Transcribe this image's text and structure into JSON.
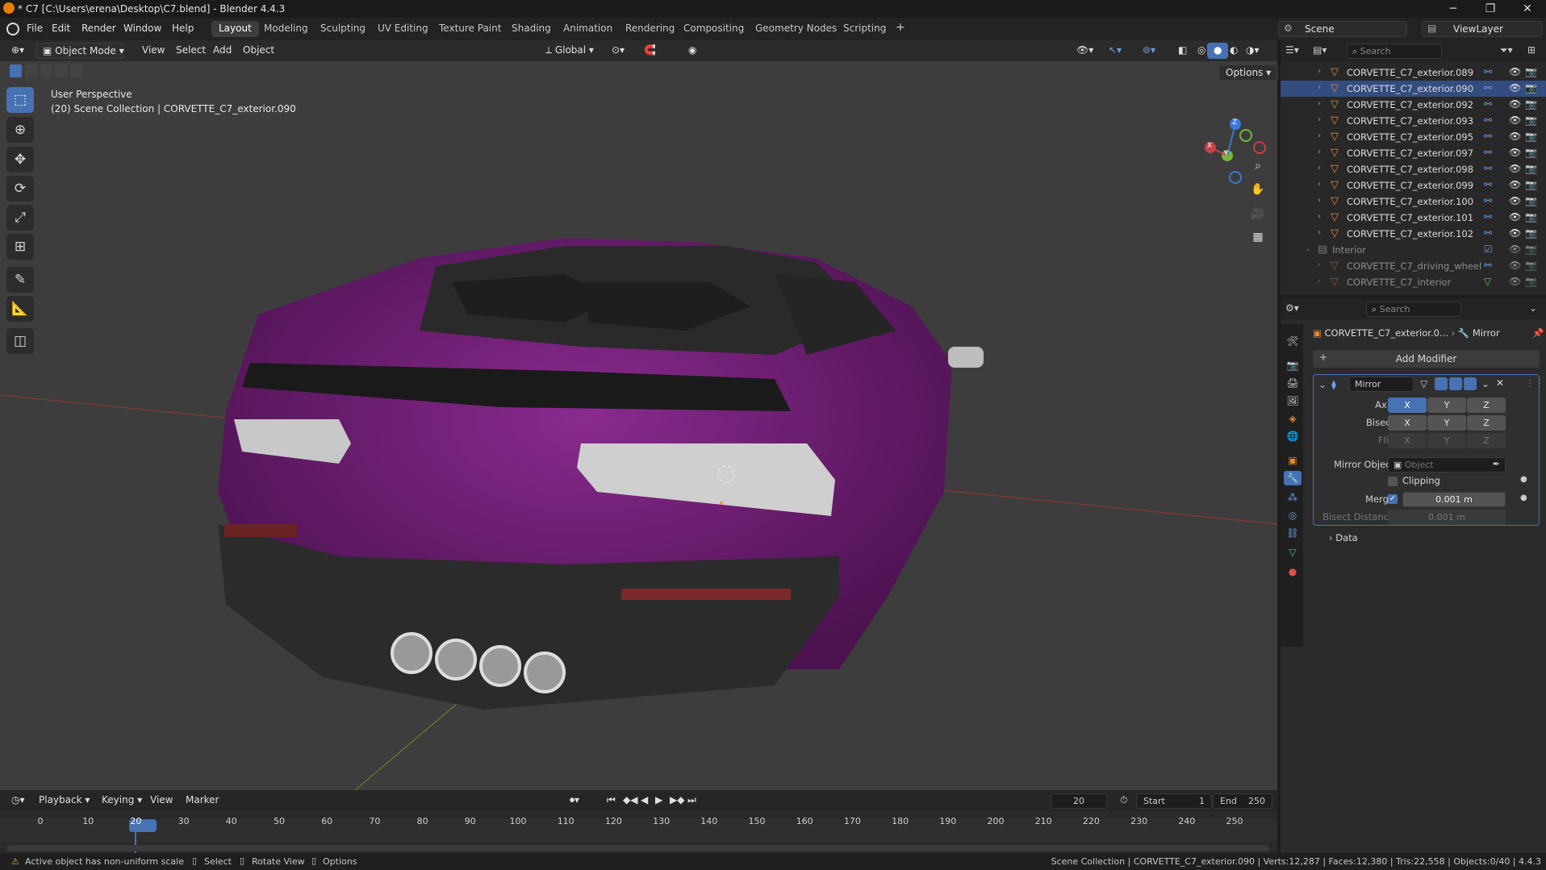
{
  "titlebar": {
    "title": "* C7 [C:\\Users\\erena\\Desktop\\C7.blend] - Blender 4.4.3",
    "min": "─",
    "max": "❐",
    "close": "✕"
  },
  "menu": {
    "items": [
      "File",
      "Edit",
      "Render",
      "Window",
      "Help"
    ]
  },
  "workspaces": [
    "Layout",
    "Modeling",
    "Sculpting",
    "UV Editing",
    "Texture Paint",
    "Shading",
    "Animation",
    "Rendering",
    "Compositing",
    "Geometry Nodes",
    "Scripting"
  ],
  "workspace_add": "+",
  "scene": {
    "name": "Scene",
    "view_layer": "ViewLayer"
  },
  "viewport_header": {
    "mode": "Object Mode",
    "view": "View",
    "select": "Select",
    "add": "Add",
    "object": "Object",
    "orientation": "Global",
    "options": "Options"
  },
  "viewport": {
    "perspective": "User Perspective",
    "collection_info": "(20) Scene Collection | CORVETTE_C7_exterior.090"
  },
  "gizmo": {
    "x": "X",
    "y": "Y",
    "z": "Z"
  },
  "colors": {
    "accent": "#4772b3",
    "car_body": "#6a1a6e",
    "x_axis": "#c8404a",
    "y_axis": "#7ab33a",
    "z_axis": "#3a78d6",
    "mesh_icon": "#e08a3c"
  },
  "outliner": {
    "search_placeholder": "Search",
    "rows": [
      {
        "name": "CORVETTE_C7_exterior.089"
      },
      {
        "name": "CORVETTE_C7_exterior.090"
      },
      {
        "name": "CORVETTE_C7_exterior.092"
      },
      {
        "name": "CORVETTE_C7_exterior.093"
      },
      {
        "name": "CORVETTE_C7_exterior.095"
      },
      {
        "name": "CORVETTE_C7_exterior.097"
      },
      {
        "name": "CORVETTE_C7_exterior.098"
      },
      {
        "name": "CORVETTE_C7_exterior.099"
      },
      {
        "name": "CORVETTE_C7_exterior.100"
      },
      {
        "name": "CORVETTE_C7_exterior.101"
      },
      {
        "name": "CORVETTE_C7_exterior.102"
      }
    ],
    "collection": "Interior",
    "interior_rows": [
      {
        "name": "CORVETTE_C7_driving_wheel"
      },
      {
        "name": "CORVETTE_C7_interior"
      }
    ]
  },
  "properties": {
    "search_placeholder": "Search",
    "object_name": "CORVETTE_C7_exterior.0...",
    "modifier_crumb": "Mirror",
    "add_modifier": "Add Modifier",
    "modifier_name": "Mirror",
    "axis_label": "Axis",
    "bisect_label": "Bisect",
    "flip_label": "Flip",
    "axes": [
      "X",
      "Y",
      "Z"
    ],
    "axis_active": "X",
    "mirror_object_label": "Mirror Object",
    "mirror_object_placeholder": "Object",
    "clipping_label": "Clipping",
    "clipping": false,
    "merge_label": "Merge",
    "merge": true,
    "merge_value": "0.001 m",
    "bisect_distance_label": "Bisect Distance",
    "bisect_distance_value": "0.001 m",
    "data_label": "Data"
  },
  "timeline": {
    "playback": "Playback",
    "keying": "Keying",
    "view": "View",
    "marker": "Marker",
    "current_frame": "20",
    "start_label": "Start",
    "start": "1",
    "end_label": "End",
    "end": "250",
    "ticks": [
      "0",
      "10",
      "20",
      "30",
      "40",
      "50",
      "60",
      "70",
      "80",
      "90",
      "100",
      "110",
      "120",
      "130",
      "140",
      "150",
      "160",
      "170",
      "180",
      "190",
      "200",
      "210",
      "220",
      "230",
      "240",
      "250"
    ]
  },
  "status": {
    "hint": "Active object has non-uniform scale",
    "select": "Select",
    "rotate": "Rotate View",
    "options": "Options",
    "stats": "Scene Collection | CORVETTE_C7_exterior.090 | Verts:12,287 | Faces:12,380 | Tris:22,558 | Objects:0/40 | 4.4.3"
  }
}
